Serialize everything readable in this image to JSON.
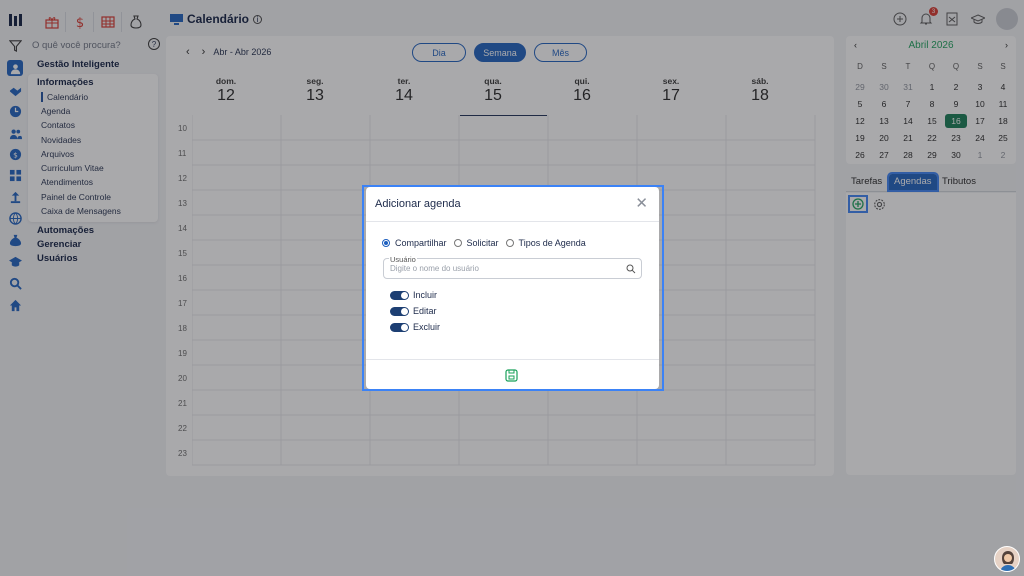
{
  "app": {
    "title": "Calendário",
    "info_glyph": "i"
  },
  "sidebar": {
    "search_placeholder": "O quê você procura?",
    "help_glyph": "?",
    "menu": [
      {
        "label": "Gestão Inteligente"
      },
      {
        "label": "Informações",
        "expanded": true,
        "items": [
          {
            "label": "Calendário",
            "active": true
          },
          {
            "label": "Agenda"
          },
          {
            "label": "Contatos"
          },
          {
            "label": "Novidades"
          },
          {
            "label": "Arquivos"
          },
          {
            "label": "Curriculum Vitae"
          },
          {
            "label": "Atendimentos"
          },
          {
            "label": "Painel de Controle"
          },
          {
            "label": "Caixa de Mensagens"
          }
        ]
      },
      {
        "label": "Automações"
      },
      {
        "label": "Gerenciar"
      },
      {
        "label": "Usuários"
      }
    ]
  },
  "topbar": {
    "notification_count": "3",
    "icons": [
      "add-circle-icon",
      "bell-icon",
      "report-icon",
      "graduation-cap-icon",
      "user-avatar-icon"
    ]
  },
  "calendar": {
    "range_label": "Abr - Abr 2026",
    "prev_glyph": "‹",
    "next_glyph": "›",
    "views": [
      {
        "label": "Dia",
        "active": false
      },
      {
        "label": "Semana",
        "active": true
      },
      {
        "label": "Mês",
        "active": false
      }
    ],
    "days": [
      {
        "name": "dom.",
        "num": "12"
      },
      {
        "name": "seg.",
        "num": "13"
      },
      {
        "name": "ter.",
        "num": "14"
      },
      {
        "name": "qua.",
        "num": "15",
        "highlight": true
      },
      {
        "name": "qui.",
        "num": "16"
      },
      {
        "name": "sex.",
        "num": "17"
      },
      {
        "name": "sáb.",
        "num": "18"
      }
    ],
    "hours": [
      "10",
      "11",
      "12",
      "13",
      "14",
      "15",
      "16",
      "17",
      "18",
      "19",
      "20",
      "21",
      "22",
      "23"
    ]
  },
  "mini_calendar": {
    "month": "Abril 2026",
    "prev_glyph": "‹",
    "next_glyph": "›",
    "weekdays": [
      "D",
      "S",
      "T",
      "Q",
      "Q",
      "S",
      "S"
    ],
    "weeks": [
      [
        "29",
        "30",
        "31",
        "1",
        "2",
        "3",
        "4"
      ],
      [
        "5",
        "6",
        "7",
        "8",
        "9",
        "10",
        "11"
      ],
      [
        "12",
        "13",
        "14",
        "15",
        "16",
        "17",
        "18"
      ],
      [
        "19",
        "20",
        "21",
        "22",
        "23",
        "24",
        "25"
      ],
      [
        "26",
        "27",
        "28",
        "29",
        "30",
        "1",
        "2"
      ]
    ],
    "today": "16",
    "accent": "#19a05a"
  },
  "right_tabs": [
    {
      "label": "Tarefas",
      "active": false
    },
    {
      "label": "Agendas",
      "active": true
    },
    {
      "label": "Tributos",
      "active": false
    }
  ],
  "modal": {
    "title": "Adicionar agenda",
    "close_glyph": "✕",
    "options": [
      {
        "label": "Compartilhar",
        "selected": true
      },
      {
        "label": "Solicitar",
        "selected": false
      },
      {
        "label": "Tipos de Agenda",
        "selected": false
      }
    ],
    "user_field": {
      "label": "Usuário",
      "placeholder": "Digite o nome do usuário",
      "value": ""
    },
    "permissions": [
      {
        "label": "Incluir",
        "on": true
      },
      {
        "label": "Editar",
        "on": true
      },
      {
        "label": "Excluir",
        "on": true
      }
    ]
  },
  "colors": {
    "primary": "#1c5fbf",
    "focus_outline": "#3b82f6",
    "today_green": "#137a52",
    "save_icon": "#19a05a",
    "brand_red": "#d9342b"
  }
}
